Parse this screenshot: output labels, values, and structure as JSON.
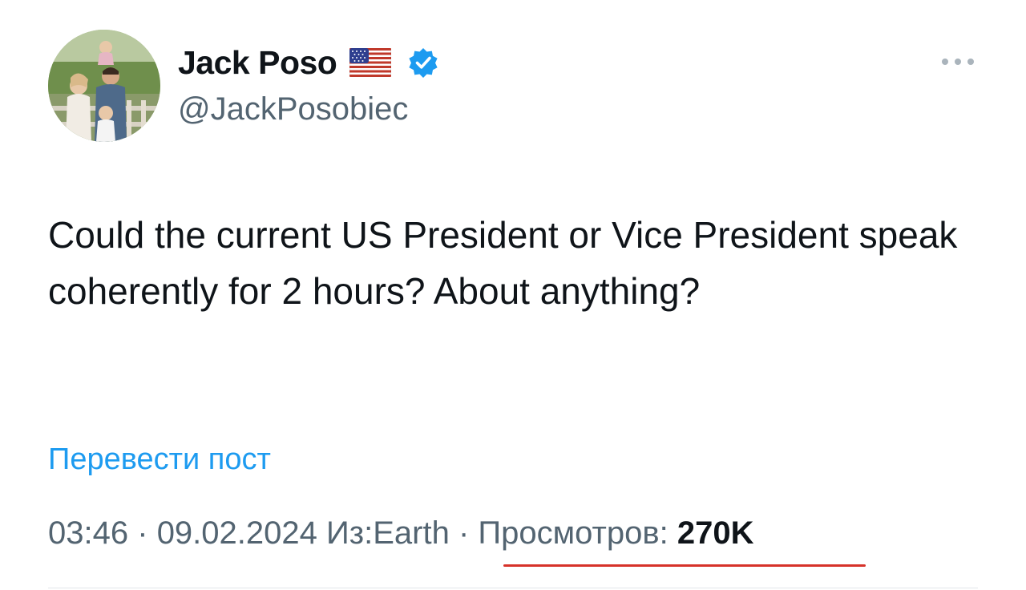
{
  "author": {
    "display_name": "Jack Poso",
    "flag_emoji": "🇺🇸",
    "verified": true,
    "handle": "@JackPosobiec"
  },
  "tweet": {
    "text": "Could the current US President or Vice President speak coherently for 2 hours? About anything?",
    "translate_label": "Перевести пост"
  },
  "meta": {
    "time": "03:46",
    "separator": "·",
    "date": "09.02.2024",
    "location": "Из:Earth",
    "views_label": "Просмотров:",
    "views_count": "270K"
  },
  "colors": {
    "link_blue": "#1d9bf0",
    "verified_blue": "#1d9bf0",
    "secondary_text": "#536471",
    "annotation_red": "#d6322a"
  },
  "icons": {
    "more": "more-horizontal-icon",
    "verified": "verified-badge-icon",
    "flag": "us-flag-icon"
  }
}
